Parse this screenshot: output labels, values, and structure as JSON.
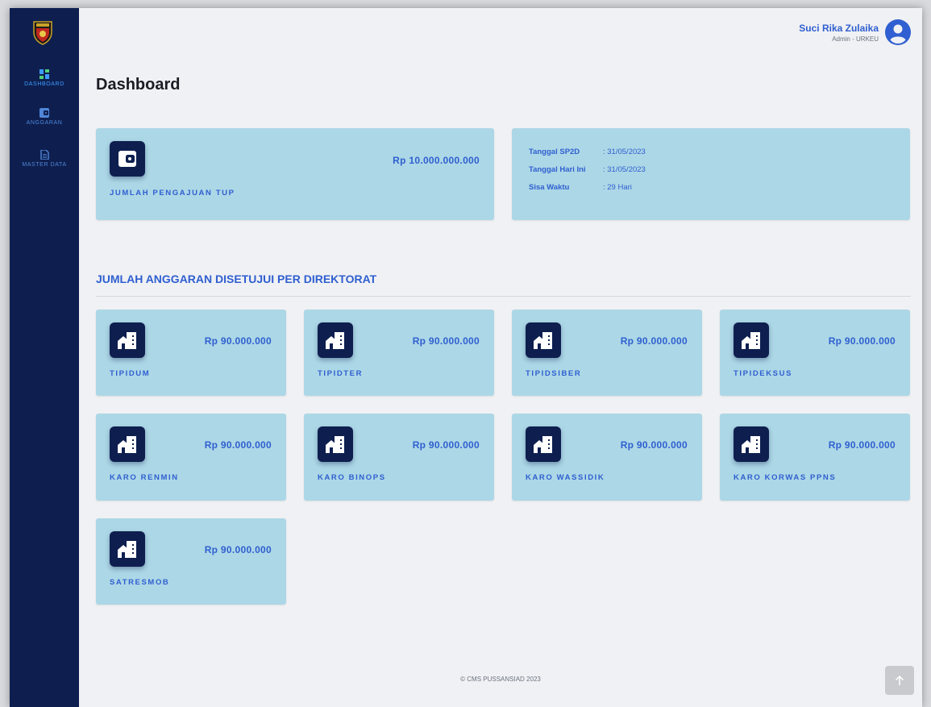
{
  "sidebar": {
    "items": [
      {
        "label": "DASHBOARD",
        "icon": "dashboard-icon"
      },
      {
        "label": "ANGGARAN",
        "icon": "wallet-icon"
      },
      {
        "label": "MASTER DATA",
        "icon": "document-icon"
      }
    ]
  },
  "user": {
    "name": "Suci Rika Zulaika",
    "role": "Admin - URKEU"
  },
  "page": {
    "title": "Dashboard"
  },
  "tup": {
    "amount": "Rp 10.000.000.000",
    "label": "JUMLAH PENGAJUAN TUP"
  },
  "info": {
    "rows": [
      {
        "key": "Tanggal SP2D",
        "value": ": 31/05/2023"
      },
      {
        "key": "Tanggal Hari Ini",
        "value": ": 31/05/2023"
      },
      {
        "key": "Sisa Waktu",
        "value": ": 29 Hari"
      }
    ]
  },
  "section": {
    "title": "JUMLAH ANGGARAN DISETUJUI PER DIREKTORAT"
  },
  "directorates": [
    {
      "label": "TIPIDUM",
      "amount": "Rp 90.000.000"
    },
    {
      "label": "TIPIDTER",
      "amount": "Rp 90.000.000"
    },
    {
      "label": "TIPIDSIBER",
      "amount": "Rp 90.000.000"
    },
    {
      "label": "TIPIDEKSUS",
      "amount": "Rp 90.000.000"
    },
    {
      "label": "KARO RENMIN",
      "amount": "Rp 90.000.000"
    },
    {
      "label": "KARO BINOPS",
      "amount": "Rp 90.000.000"
    },
    {
      "label": "KARO WASSIDIK",
      "amount": "Rp 90.000.000"
    },
    {
      "label": "KARO KORWAS PPNS",
      "amount": "Rp 90.000.000"
    },
    {
      "label": "SATRESMOB",
      "amount": "Rp 90.000.000"
    }
  ],
  "footer": {
    "text": "© CMS PUSSANSIAD 2023"
  },
  "colors": {
    "sidebar": "#0e1f4f",
    "card": "#acd7e6",
    "accent": "#2f5fd0",
    "background": "#f0f1f4"
  }
}
